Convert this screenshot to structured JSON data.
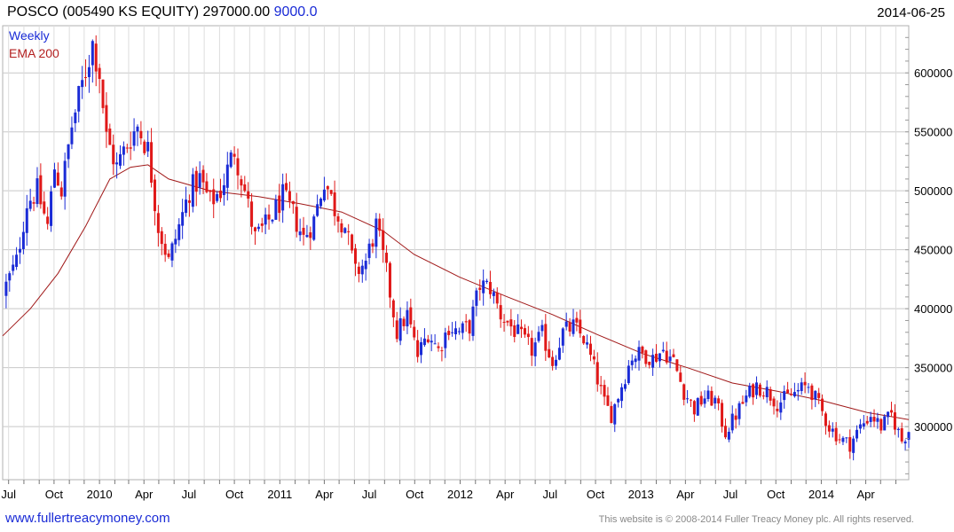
{
  "header": {
    "title": "POSCO (005490 KS EQUITY) 297000.00",
    "change": "9000.0",
    "date": "2014-06-25"
  },
  "footer": {
    "site": "www.fullertreacymoney.com",
    "copyright": "This website is © 2008-2014 Fuller Treacy Money plc. All rights reserved."
  },
  "colors": {
    "up": "#1a2bd6",
    "down": "#e01818",
    "ema": "#a01818",
    "grid": "#c8c8c8"
  },
  "chart_data": {
    "type": "candlestick",
    "legend": [
      "Weekly",
      "EMA 200"
    ],
    "legend_placement": "top-left",
    "grid": true,
    "x_range": [
      "2009-06-19",
      "2014-06-27"
    ],
    "ylim": [
      255000,
      640000
    ],
    "y_ticks": [
      300000,
      350000,
      400000,
      450000,
      500000,
      550000,
      600000
    ],
    "y_tick_labels": [
      "300000",
      "350000",
      "400000",
      "450000",
      "500000",
      "550000",
      "600000"
    ],
    "x_ticks": [
      {
        "date": "2009-07-01",
        "label": "Jul"
      },
      {
        "date": "2009-10-01",
        "label": "Oct"
      },
      {
        "date": "2010-01-01",
        "label": "2010"
      },
      {
        "date": "2010-04-01",
        "label": "Apr"
      },
      {
        "date": "2010-07-01",
        "label": "Jul"
      },
      {
        "date": "2010-10-01",
        "label": "Oct"
      },
      {
        "date": "2011-01-01",
        "label": "2011"
      },
      {
        "date": "2011-04-01",
        "label": "Apr"
      },
      {
        "date": "2011-07-01",
        "label": "Jul"
      },
      {
        "date": "2011-10-01",
        "label": "Oct"
      },
      {
        "date": "2012-01-01",
        "label": "2012"
      },
      {
        "date": "2012-04-01",
        "label": "Apr"
      },
      {
        "date": "2012-07-01",
        "label": "Jul"
      },
      {
        "date": "2012-10-01",
        "label": "Oct"
      },
      {
        "date": "2013-01-01",
        "label": "2013"
      },
      {
        "date": "2013-04-01",
        "label": "Apr"
      },
      {
        "date": "2013-07-01",
        "label": "Jul"
      },
      {
        "date": "2013-10-01",
        "label": "Oct"
      },
      {
        "date": "2014-01-01",
        "label": "2014"
      },
      {
        "date": "2014-04-01",
        "label": "Apr"
      }
    ],
    "close_path": [
      [
        "2009-06-26",
        420000
      ],
      [
        "2009-07-17",
        440000
      ],
      [
        "2009-08-07",
        490000
      ],
      [
        "2009-08-28",
        500000
      ],
      [
        "2009-09-18",
        470000
      ],
      [
        "2009-10-02",
        520000
      ],
      [
        "2009-10-16",
        500000
      ],
      [
        "2009-11-06",
        555000
      ],
      [
        "2009-11-27",
        590000
      ],
      [
        "2009-12-18",
        625000
      ],
      [
        "2010-01-01",
        600000
      ],
      [
        "2010-01-15",
        545000
      ],
      [
        "2010-02-05",
        520000
      ],
      [
        "2010-02-26",
        540000
      ],
      [
        "2010-03-19",
        555000
      ],
      [
        "2010-04-09",
        535000
      ],
      [
        "2010-04-30",
        470000
      ],
      [
        "2010-05-21",
        440000
      ],
      [
        "2010-06-11",
        470000
      ],
      [
        "2010-07-02",
        500000
      ],
      [
        "2010-07-23",
        510000
      ],
      [
        "2010-08-13",
        490000
      ],
      [
        "2010-09-03",
        500000
      ],
      [
        "2010-10-01",
        535000
      ],
      [
        "2010-10-22",
        500000
      ],
      [
        "2010-11-12",
        460000
      ],
      [
        "2010-12-03",
        470000
      ],
      [
        "2011-01-07",
        495000
      ],
      [
        "2011-01-28",
        480000
      ],
      [
        "2011-02-18",
        460000
      ],
      [
        "2011-03-11",
        475000
      ],
      [
        "2011-04-01",
        510000
      ],
      [
        "2011-04-22",
        485000
      ],
      [
        "2011-05-13",
        470000
      ],
      [
        "2011-06-03",
        430000
      ],
      [
        "2011-06-24",
        440000
      ],
      [
        "2011-07-15",
        470000
      ],
      [
        "2011-08-05",
        430000
      ],
      [
        "2011-08-26",
        380000
      ],
      [
        "2011-09-16",
        395000
      ],
      [
        "2011-10-07",
        360000
      ],
      [
        "2011-10-28",
        380000
      ],
      [
        "2011-11-18",
        365000
      ],
      [
        "2011-12-09",
        385000
      ],
      [
        "2011-12-30",
        380000
      ],
      [
        "2012-01-20",
        385000
      ],
      [
        "2012-02-10",
        420000
      ],
      [
        "2012-03-02",
        418000
      ],
      [
        "2012-03-23",
        395000
      ],
      [
        "2012-04-13",
        385000
      ],
      [
        "2012-05-04",
        375000
      ],
      [
        "2012-05-25",
        365000
      ],
      [
        "2012-06-15",
        378000
      ],
      [
        "2012-07-06",
        355000
      ],
      [
        "2012-07-27",
        380000
      ],
      [
        "2012-08-17",
        385000
      ],
      [
        "2012-09-07",
        375000
      ],
      [
        "2012-09-28",
        350000
      ],
      [
        "2012-10-19",
        320000
      ],
      [
        "2012-11-02",
        310000
      ],
      [
        "2012-11-23",
        335000
      ],
      [
        "2012-12-14",
        360000
      ],
      [
        "2013-01-04",
        362000
      ],
      [
        "2013-01-25",
        358000
      ],
      [
        "2013-02-15",
        365000
      ],
      [
        "2013-03-08",
        355000
      ],
      [
        "2013-03-29",
        330000
      ],
      [
        "2013-04-19",
        315000
      ],
      [
        "2013-05-10",
        325000
      ],
      [
        "2013-05-31",
        322000
      ],
      [
        "2013-06-21",
        295000
      ],
      [
        "2013-07-12",
        310000
      ],
      [
        "2013-08-02",
        325000
      ],
      [
        "2013-08-23",
        335000
      ],
      [
        "2013-09-13",
        330000
      ],
      [
        "2013-10-04",
        320000
      ],
      [
        "2013-10-25",
        325000
      ],
      [
        "2013-11-15",
        330000
      ],
      [
        "2013-12-06",
        335000
      ],
      [
        "2013-12-27",
        318000
      ],
      [
        "2014-01-17",
        300000
      ],
      [
        "2014-02-07",
        290000
      ],
      [
        "2014-02-28",
        285000
      ],
      [
        "2014-03-21",
        300000
      ],
      [
        "2014-04-11",
        310000
      ],
      [
        "2014-05-02",
        300000
      ],
      [
        "2014-05-23",
        310000
      ],
      [
        "2014-06-13",
        288000
      ],
      [
        "2014-06-27",
        297000
      ]
    ],
    "ema_200": [
      [
        "2009-06-19",
        377000
      ],
      [
        "2009-08-14",
        400000
      ],
      [
        "2009-10-09",
        430000
      ],
      [
        "2009-12-04",
        470000
      ],
      [
        "2010-01-22",
        510000
      ],
      [
        "2010-03-05",
        520000
      ],
      [
        "2010-04-09",
        522000
      ],
      [
        "2010-05-21",
        510000
      ],
      [
        "2010-08-13",
        500000
      ],
      [
        "2010-11-19",
        495000
      ],
      [
        "2011-02-11",
        489000
      ],
      [
        "2011-05-06",
        482000
      ],
      [
        "2011-07-29",
        466000
      ],
      [
        "2011-09-30",
        446000
      ],
      [
        "2011-12-30",
        427000
      ],
      [
        "2012-04-06",
        410000
      ],
      [
        "2012-07-06",
        395000
      ],
      [
        "2012-10-05",
        378000
      ],
      [
        "2013-01-04",
        362000
      ],
      [
        "2013-04-05",
        350000
      ],
      [
        "2013-07-05",
        337000
      ],
      [
        "2013-10-04",
        330000
      ],
      [
        "2014-01-03",
        322000
      ],
      [
        "2014-04-04",
        312000
      ],
      [
        "2014-06-27",
        306000
      ]
    ]
  }
}
